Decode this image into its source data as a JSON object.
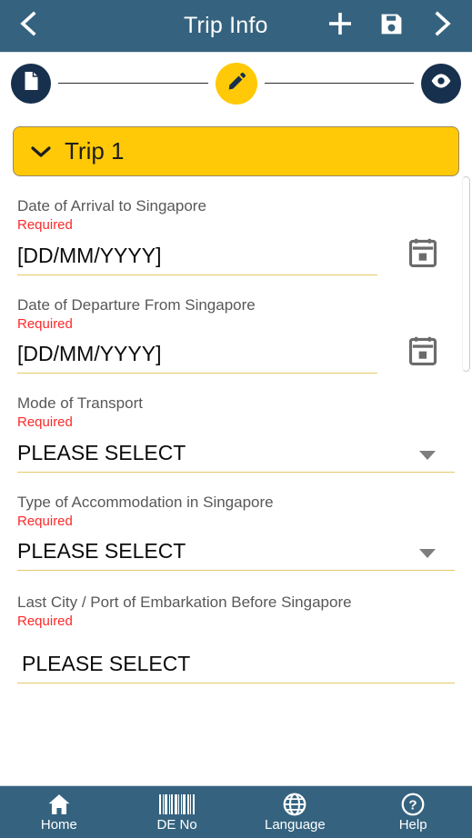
{
  "appbar": {
    "back_icon": "chevron-left-icon",
    "title": "Trip Info",
    "add_icon": "plus-icon",
    "save_icon": "floppy-disk-save-icon",
    "next_icon": "chevron-right-icon"
  },
  "stepper": {
    "steps": [
      {
        "name": "document-step",
        "icon": "document-icon",
        "active": false
      },
      {
        "name": "edit-step",
        "icon": "pencil-edit-icon",
        "active": true
      },
      {
        "name": "review-step",
        "icon": "eye-icon",
        "active": false
      }
    ],
    "active_color": "#ffc907",
    "inactive_color": "#17304d"
  },
  "trip_panel": {
    "chevron_icon": "chevron-down-icon",
    "label": "Trip 1",
    "background": "#ffc907"
  },
  "form": {
    "required_text": "Required",
    "required_color": "#fc2a2a",
    "underline_color": "#e5c96a",
    "fields": [
      {
        "id": "arrival-date",
        "label": "Date of Arrival to Singapore",
        "required": "Required",
        "value": "",
        "placeholder": "[DD/MM/YYYY]",
        "control": "date",
        "icon": "calendar-icon"
      },
      {
        "id": "departure-date",
        "label": "Date of Departure From Singapore",
        "required": "Required",
        "value": "",
        "placeholder": "[DD/MM/YYYY]",
        "control": "date",
        "icon": "calendar-icon"
      },
      {
        "id": "mode-of-transport",
        "label": "Mode of Transport",
        "required": "Required",
        "value": "PLEASE SELECT",
        "placeholder": "PLEASE SELECT",
        "control": "select",
        "icon": "caret-down-icon"
      },
      {
        "id": "accommodation-type",
        "label": "Type of Accommodation in Singapore",
        "required": "Required",
        "value": "PLEASE SELECT",
        "placeholder": "PLEASE SELECT",
        "control": "select",
        "icon": "caret-down-icon"
      },
      {
        "id": "last-city-port",
        "label": "Last City / Port of Embarkation Before Singapore",
        "required": "Required",
        "value": "",
        "placeholder": "PLEASE SELECT",
        "control": "text",
        "icon": ""
      }
    ]
  },
  "bottom_nav": {
    "items": [
      {
        "id": "home",
        "label": "Home",
        "icon": "home-icon"
      },
      {
        "id": "de-no",
        "label": "DE No",
        "icon": "barcode-icon"
      },
      {
        "id": "language",
        "label": "Language",
        "icon": "globe-icon"
      },
      {
        "id": "help",
        "label": "Help",
        "icon": "question-circle-icon"
      }
    ],
    "background": "#35637f"
  }
}
